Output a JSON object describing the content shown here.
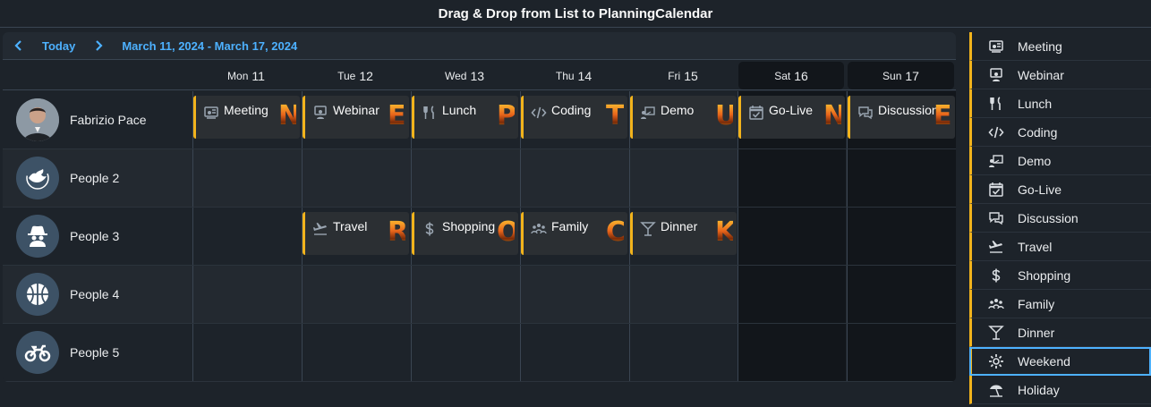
{
  "title": "Drag & Drop from List to PlanningCalendar",
  "toolbar": {
    "prev_icon": "chevron-left-icon",
    "today_label": "Today",
    "next_icon": "chevron-right-icon",
    "date_range": "March 11, 2024 - March 17, 2024"
  },
  "days": [
    {
      "dow": "Mon",
      "num": "11",
      "weekend": false
    },
    {
      "dow": "Tue",
      "num": "12",
      "weekend": false
    },
    {
      "dow": "Wed",
      "num": "13",
      "weekend": false
    },
    {
      "dow": "Thu",
      "num": "14",
      "weekend": false
    },
    {
      "dow": "Fri",
      "num": "15",
      "weekend": false
    },
    {
      "dow": "Sat",
      "num": "16",
      "weekend": true
    },
    {
      "dow": "Sun",
      "num": "17",
      "weekend": true
    }
  ],
  "people": [
    {
      "name": "Fabrizio Pace",
      "avatar_icon": "person-photo-icon"
    },
    {
      "name": "People 2",
      "avatar_icon": "bird-icon"
    },
    {
      "name": "People 3",
      "avatar_icon": "spy-icon"
    },
    {
      "name": "People 4",
      "avatar_icon": "basketball-icon"
    },
    {
      "name": "People 5",
      "avatar_icon": "motorcycle-icon"
    }
  ],
  "appointments": [
    {
      "row": 0,
      "day": 0,
      "title": "Meeting",
      "icon": "meeting-icon",
      "letter": "N"
    },
    {
      "row": 0,
      "day": 1,
      "title": "Webinar",
      "icon": "webinar-icon",
      "letter": "E"
    },
    {
      "row": 0,
      "day": 2,
      "title": "Lunch",
      "icon": "lunch-icon",
      "letter": "P"
    },
    {
      "row": 0,
      "day": 3,
      "title": "Coding",
      "icon": "coding-icon",
      "letter": "T"
    },
    {
      "row": 0,
      "day": 4,
      "title": "Demo",
      "icon": "demo-icon",
      "letter": "U"
    },
    {
      "row": 0,
      "day": 5,
      "title": "Go-Live",
      "icon": "go-live-icon",
      "letter": "N"
    },
    {
      "row": 0,
      "day": 6,
      "title": "Discussion",
      "icon": "discussion-icon",
      "letter": "E"
    },
    {
      "row": 2,
      "day": 1,
      "title": "Travel",
      "icon": "travel-icon",
      "letter": "R"
    },
    {
      "row": 2,
      "day": 2,
      "title": "Shopping",
      "icon": "shopping-icon",
      "letter": "O"
    },
    {
      "row": 2,
      "day": 3,
      "title": "Family",
      "icon": "family-icon",
      "letter": "C"
    },
    {
      "row": 2,
      "day": 4,
      "title": "Dinner",
      "icon": "dinner-icon",
      "letter": "K"
    }
  ],
  "list_items": [
    {
      "label": "Meeting",
      "icon": "meeting-icon",
      "focused": false
    },
    {
      "label": "Webinar",
      "icon": "webinar-icon",
      "focused": false
    },
    {
      "label": "Lunch",
      "icon": "lunch-icon",
      "focused": false
    },
    {
      "label": "Coding",
      "icon": "coding-icon",
      "focused": false
    },
    {
      "label": "Demo",
      "icon": "demo-icon",
      "focused": false
    },
    {
      "label": "Go-Live",
      "icon": "go-live-icon",
      "focused": false
    },
    {
      "label": "Discussion",
      "icon": "discussion-icon",
      "focused": false
    },
    {
      "label": "Travel",
      "icon": "travel-icon",
      "focused": false
    },
    {
      "label": "Shopping",
      "icon": "shopping-icon",
      "focused": false
    },
    {
      "label": "Family",
      "icon": "family-icon",
      "focused": false
    },
    {
      "label": "Dinner",
      "icon": "dinner-icon",
      "focused": false
    },
    {
      "label": "Weekend",
      "icon": "gear-icon",
      "focused": true
    },
    {
      "label": "Holiday",
      "icon": "beach-umbrella-icon",
      "focused": false
    }
  ],
  "colors": {
    "accent": "#4db1ff",
    "appointment_bar": "#f2b31c",
    "background": "#1d232a",
    "weekend": "#12161b"
  }
}
